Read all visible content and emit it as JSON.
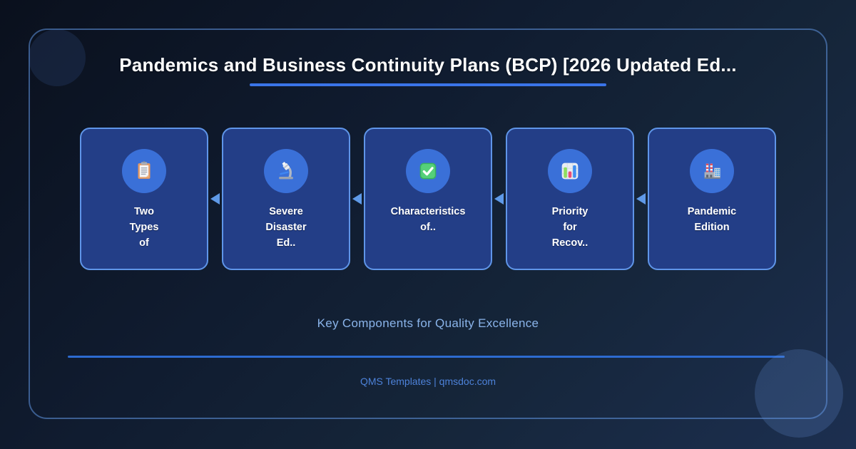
{
  "page": {
    "title": "Pandemics and Business Continuity Plans (BCP) [2026 Updated Ed...",
    "tagline": "Key Components for Quality Excellence",
    "footer": "QMS Templates | qmsdoc.com"
  },
  "colors": {
    "background_top": "#0a101d",
    "background_bottom": "#1c2f50",
    "frame_border": "#6196e2",
    "card_background": "#233e87",
    "card_border": "#5f95e8",
    "icon_circle": "#3a70d8",
    "arrow": "#5f9ae8",
    "title_underline": "#3a74e8",
    "tagline_text": "#8ab4ea",
    "divider": "#2d6bd0",
    "footer_text": "#4d82d9",
    "title_text": "#ffffff",
    "card_text": "#ffffff"
  },
  "cards": [
    {
      "icon": "clipboard-icon",
      "lines": [
        "Two",
        "Types",
        "of"
      ]
    },
    {
      "icon": "microscope-icon",
      "lines": [
        "Severe",
        "Disaster",
        "Ed.."
      ]
    },
    {
      "icon": "check-icon",
      "lines": [
        "Characteristics",
        "of.."
      ]
    },
    {
      "icon": "bar-chart-icon",
      "lines": [
        "Priority",
        "for",
        "Recov.."
      ]
    },
    {
      "icon": "factory-icon",
      "lines": [
        "Pandemic",
        "Edition"
      ]
    }
  ]
}
